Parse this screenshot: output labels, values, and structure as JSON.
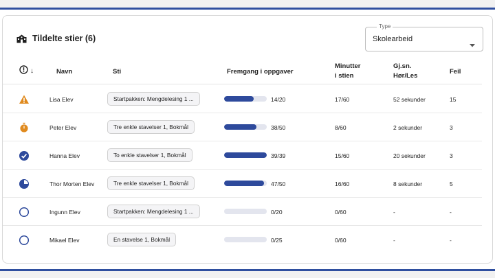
{
  "header": {
    "title": "Tildelte stier (6)",
    "type_select": {
      "legend": "Type",
      "value": "Skolearbeid"
    }
  },
  "columns": {
    "status_sort": "↓",
    "name": "Navn",
    "path": "Sti",
    "progress": "Fremgang i oppgaver",
    "minutes_line1": "Minutter",
    "minutes_line2": "i stien",
    "avg_line1": "Gj.sn.",
    "avg_line2": "Hør/Les",
    "errors": "Feil"
  },
  "rows": [
    {
      "status": "warning-icon",
      "name": "Lisa Elev",
      "path": "Startpakken: Mengdelesing 1 ...",
      "progress_text": "14/20",
      "progress_fraction": 0.7,
      "minutes": "17/60",
      "avg": "52 sekunder",
      "errors": "15"
    },
    {
      "status": "stopwatch-icon",
      "name": "Peter Elev",
      "path": "Tre enkle stavelser 1, Bokmål",
      "progress_text": "38/50",
      "progress_fraction": 0.76,
      "minutes": "8/60",
      "avg": "2 sekunder",
      "errors": "3"
    },
    {
      "status": "check-circle-icon",
      "name": "Hanna Elev",
      "path": "To enkle stavelser 1, Bokmål",
      "progress_text": "39/39",
      "progress_fraction": 1.0,
      "minutes": "15/60",
      "avg": "20 sekunder",
      "errors": "3"
    },
    {
      "status": "pie-progress-icon",
      "name": "Thor Morten Elev",
      "path": "Tre enkle stavelser 1, Bokmål",
      "progress_text": "47/50",
      "progress_fraction": 0.94,
      "minutes": "16/60",
      "avg": "8 sekunder",
      "errors": "5"
    },
    {
      "status": "empty-circle-icon",
      "name": "Ingunn Elev",
      "path": "Startpakken: Mengdelesing 1 ...",
      "progress_text": "0/20",
      "progress_fraction": 0,
      "minutes": "0/60",
      "avg": "-",
      "errors": "-"
    },
    {
      "status": "empty-circle-icon",
      "name": "Mikael Elev",
      "path": "En stavelse 1, Bokmål",
      "progress_text": "0/25",
      "progress_fraction": 0,
      "minutes": "0/60",
      "avg": "-",
      "errors": "-"
    }
  ],
  "colors": {
    "accent": "#2e4a9c",
    "warning": "#e08a1e",
    "track": "#e3e5ee",
    "frame_bar": "#2f4f9f"
  }
}
